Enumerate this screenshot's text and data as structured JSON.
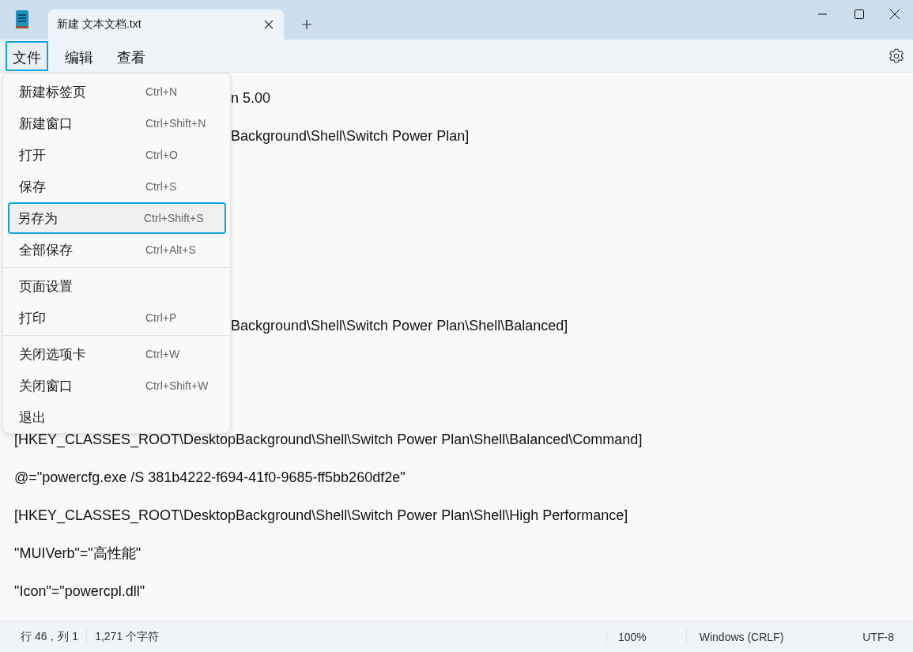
{
  "tab": {
    "title": "新建 文本文档.txt",
    "selected": true
  },
  "menubar": [
    {
      "label": "文件",
      "selected": true
    },
    {
      "label": "编辑",
      "selected": false
    },
    {
      "label": "查看",
      "selected": false
    }
  ],
  "file_menu": [
    {
      "kind": "item",
      "label": "新建标签页",
      "shortcut": "Ctrl+N",
      "selected": false
    },
    {
      "kind": "item",
      "label": "新建窗口",
      "shortcut": "Ctrl+Shift+N",
      "selected": false
    },
    {
      "kind": "item",
      "label": "打开",
      "shortcut": "Ctrl+O",
      "selected": false
    },
    {
      "kind": "item",
      "label": "保存",
      "shortcut": "Ctrl+S",
      "selected": false
    },
    {
      "kind": "item",
      "label": "另存为",
      "shortcut": "Ctrl+Shift+S",
      "selected": true
    },
    {
      "kind": "item",
      "label": "全部保存",
      "shortcut": "Ctrl+Alt+S",
      "selected": false
    },
    {
      "kind": "separator"
    },
    {
      "kind": "item",
      "label": "页面设置",
      "selected": false
    },
    {
      "kind": "item",
      "label": "打印",
      "shortcut": "Ctrl+P",
      "selected": false
    },
    {
      "kind": "separator"
    },
    {
      "kind": "item",
      "label": "关闭选项卡",
      "shortcut": "Ctrl+W",
      "selected": false
    },
    {
      "kind": "item",
      "label": "关闭窗口",
      "shortcut": "Ctrl+Shift+W",
      "selected": false
    },
    {
      "kind": "item",
      "label": "退出",
      "selected": false
    }
  ],
  "editor_lines": [
    {
      "text": "n 5.00",
      "covered": true
    },
    {
      "text": "Background\\Shell\\Switch Power Plan]",
      "covered": true
    },
    {
      "text": "Background\\Shell\\Switch Power Plan\\Shell\\Balanced]",
      "covered": true
    },
    {
      "text": "[HKEY_CLASSES_ROOT\\DesktopBackground\\Shell\\Switch Power Plan\\Shell\\Balanced\\Command]"
    },
    {
      "text": "@=\"powercfg.exe /S 381b4222-f694-41f0-9685-ff5bb260df2e\""
    },
    {
      "text": "[HKEY_CLASSES_ROOT\\DesktopBackground\\Shell\\Switch Power Plan\\Shell\\High Performance]"
    },
    {
      "text": "\"MUIVerb\"=\"高性能\""
    },
    {
      "text": "\"Icon\"=\"powercpl.dll\""
    }
  ],
  "status_bar": {
    "position": "行 46，列 1",
    "characters": "1,271 个字符",
    "zoom": "100%",
    "line_ending": "Windows (CRLF)",
    "encoding": "UTF-8"
  }
}
